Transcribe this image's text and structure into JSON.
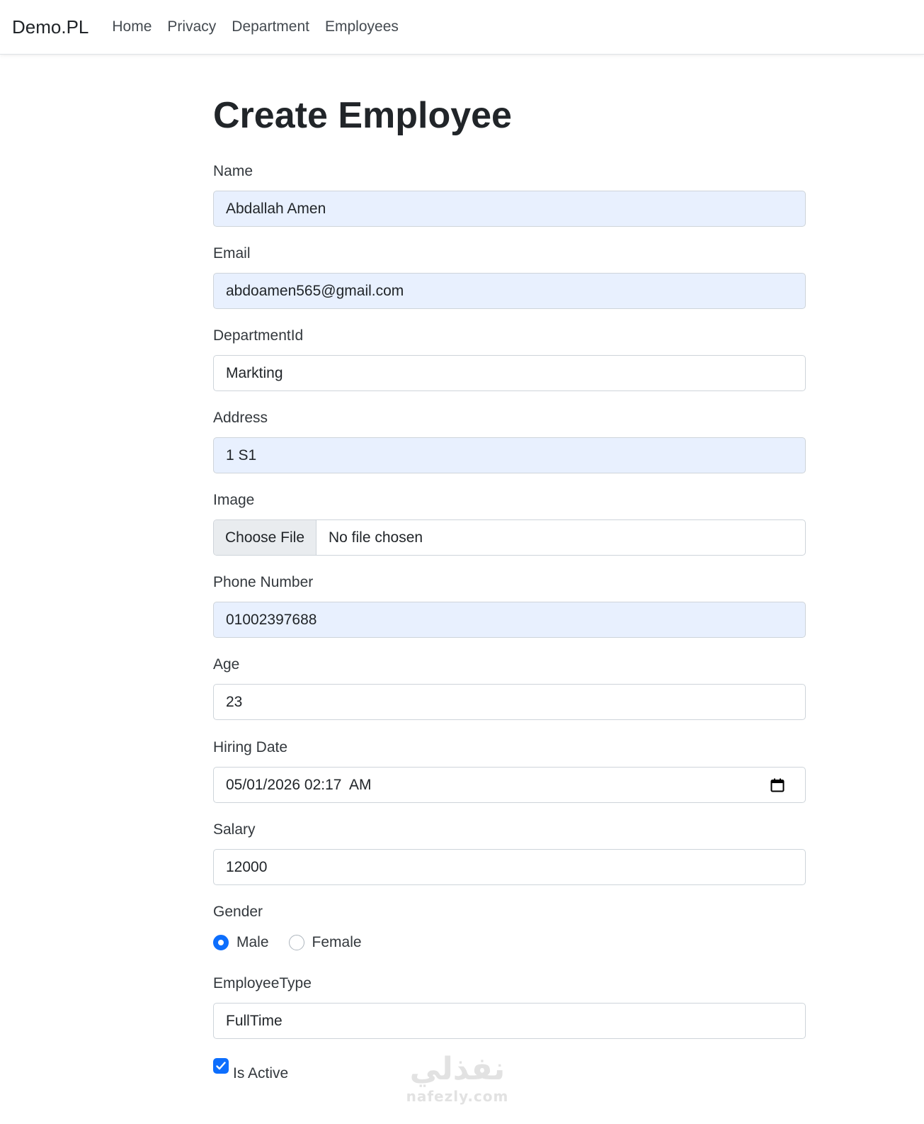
{
  "navbar": {
    "brand": "Demo.PL",
    "links": [
      "Home",
      "Privacy",
      "Department",
      "Employees"
    ]
  },
  "page": {
    "title": "Create Employee"
  },
  "form": {
    "name": {
      "label": "Name",
      "value": "Abdallah Amen"
    },
    "email": {
      "label": "Email",
      "value": "abdoamen565@gmail.com"
    },
    "department": {
      "label": "DepartmentId",
      "value": "Markting"
    },
    "address": {
      "label": "Address",
      "value": "1 S1"
    },
    "image": {
      "label": "Image",
      "button": "Choose File",
      "status": "No file chosen"
    },
    "phone": {
      "label": "Phone Number",
      "value": "01002397688"
    },
    "age": {
      "label": "Age",
      "value": "23"
    },
    "hiring_date": {
      "label": "Hiring Date",
      "value": "05/01/2026 02:17  AM",
      "icon": "calendar-icon"
    },
    "salary": {
      "label": "Salary",
      "value": "12000"
    },
    "gender": {
      "label": "Gender",
      "options": [
        "Male",
        "Female"
      ],
      "selected": "Male"
    },
    "employee_type": {
      "label": "EmployeeType",
      "value": "FullTime"
    },
    "is_active": {
      "label": "Is Active",
      "checked": true
    }
  },
  "watermark": {
    "arabic": "نفذلي",
    "latin": "nafezly.com"
  },
  "colors": {
    "primary": "#0d6efd",
    "autofill": "#e8f0fe",
    "border": "#ced4da"
  }
}
